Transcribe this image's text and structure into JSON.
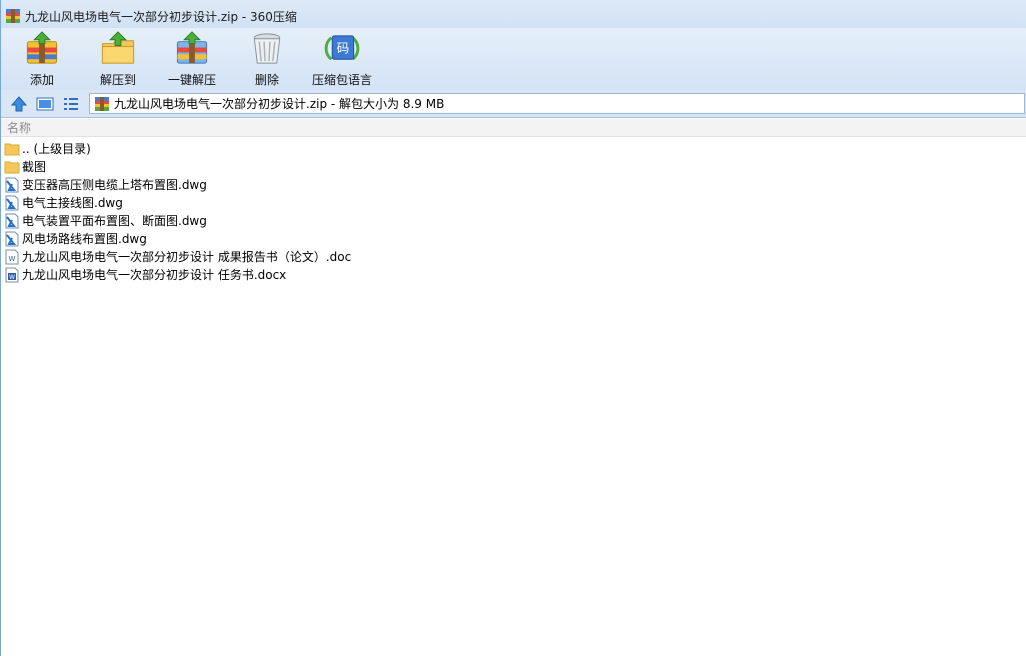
{
  "window": {
    "title": "九龙山风电场电气一次部分初步设计.zip - 360压缩"
  },
  "toolbar": {
    "buttons": [
      {
        "label": "添加",
        "icon": "add-archive-icon"
      },
      {
        "label": "解压到",
        "icon": "extract-to-icon"
      },
      {
        "label": "一键解压",
        "icon": "one-click-extract-icon"
      },
      {
        "label": "删除",
        "icon": "delete-trash-icon"
      },
      {
        "label": "压缩包语言",
        "icon": "archive-language-icon",
        "badge": "码"
      }
    ]
  },
  "navigation": {
    "up_icon": "up-arrow-icon",
    "thumbnail_icon": "thumbnail-view-icon",
    "list_icon": "list-view-icon"
  },
  "address": {
    "text": "九龙山风电场电气一次部分初步设计.zip - 解包大小为 8.9 MB"
  },
  "list": {
    "column_name": "名称",
    "items": [
      {
        "name": ".. (上级目录)",
        "type": "folder"
      },
      {
        "name": "截图",
        "type": "folder"
      },
      {
        "name": "变压器高压侧电缆上塔布置图.dwg",
        "type": "dwg"
      },
      {
        "name": "电气主接线图.dwg",
        "type": "dwg"
      },
      {
        "name": "电气装置平面布置图、断面图.dwg",
        "type": "dwg"
      },
      {
        "name": "风电场路线布置图.dwg",
        "type": "dwg"
      },
      {
        "name": "九龙山风电场电气一次部分初步设计 成果报告书（论文）.doc",
        "type": "doc"
      },
      {
        "name": "九龙山风电场电气一次部分初步设计 任务书.docx",
        "type": "docx"
      }
    ]
  },
  "colors": {
    "titlebar": "#dfeaf7",
    "toolbar": "#d3e3f5",
    "folder": "#f5c75a",
    "dwg": "#2a6fc9",
    "accent_green": "#4caf3a"
  }
}
